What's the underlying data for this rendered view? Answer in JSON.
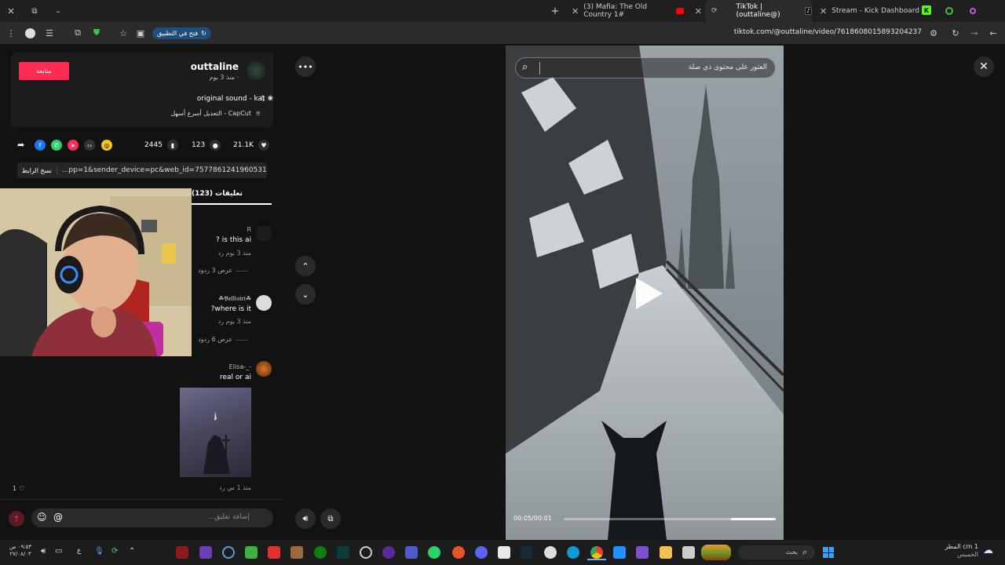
{
  "tabs": [
    {
      "label": "Stream - Kick Dashboard",
      "active": false
    },
    {
      "label": "TikTok | (outtaline@)",
      "active": true
    },
    {
      "label": "(3) Mafia: The Old Country 1#",
      "active": false
    }
  ],
  "addressbar": {
    "url": "tiktok.com/@outtaline/video/7618608015893204237",
    "open_in_app": "فتح في التطبيق"
  },
  "author": {
    "username": "outtaline",
    "time": "· منذ 3 يوم",
    "follow_label": "متابعة",
    "sound": "original sound - kat ❀",
    "capcut": "CapCut - التعديل أسرع أسهل"
  },
  "stats": {
    "likes": "21.1K",
    "comments": "123",
    "saves": "2445"
  },
  "link": {
    "text": "...pp=1&sender_device=pc&web_id=7577861241960531476",
    "copy_label": "نسخ الرابط"
  },
  "comments_tab": {
    "label": "(123) تعليقات"
  },
  "comments": [
    {
      "name": "R",
      "text": "is this ai ?",
      "meta": "منذ 3 يوم  رد",
      "replies": "عرض 3 ردود"
    },
    {
      "name": "☘𝕭𝖊𝖑𝖑𝖎𝖘𝖙𝖗𝖎☘",
      "text": "where is it?",
      "meta": "منذ 3 يوم  رد",
      "replies": "عرض 6 ردود"
    },
    {
      "name": "Elisa-_-",
      "text": "real or ai",
      "meta": "منذ 1 س  رد",
      "likes": "1"
    }
  ],
  "composer": {
    "placeholder": "إضافة تعليق..."
  },
  "video": {
    "search_placeholder": "العثور على محتوى ذي صلة",
    "time": "00:05/00:01",
    "progress": 0.79
  },
  "taskbar": {
    "search_label": "بحث",
    "weather_temp": "1 cm المطر",
    "weather_day": "الخميس",
    "clock_time": "٠٩:٥٣ ص",
    "clock_date": "٢٧/٠٨/٠٣",
    "lang": "ع"
  },
  "colors": {
    "accent": "#fe2c55",
    "open_app_bg": "#1e4f7a"
  }
}
